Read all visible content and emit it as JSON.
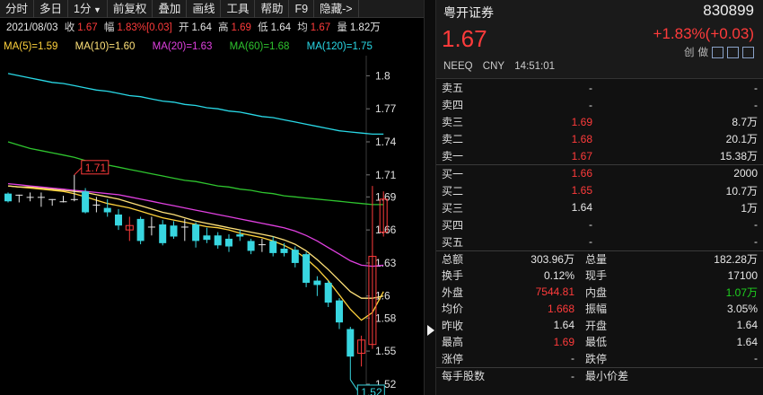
{
  "toolbar": {
    "items": [
      "分时",
      "多日",
      "1分",
      "前复权",
      "叠加",
      "画线",
      "工具",
      "帮助",
      "F9",
      "隐藏->"
    ]
  },
  "info": {
    "date": "2021/08/03",
    "close_label": "收",
    "close": "1.67",
    "range_label": "幅",
    "range": "1.83%[0.03]",
    "open_label": "开",
    "open": "1.64",
    "high_label": "高",
    "high": "1.69",
    "low_label": "低",
    "low": "1.64",
    "avg_label": "均",
    "avg": "1.67",
    "vol_label": "量",
    "vol": "1.82万"
  },
  "ma": [
    {
      "label": "MA(5)=1.59",
      "color": "#ffd23c"
    },
    {
      "label": "MA(10)=1.60",
      "color": "#ffe27a"
    },
    {
      "label": "MA(20)=1.63",
      "color": "#e040e0"
    },
    {
      "label": "MA(60)=1.68",
      "color": "#2fc52f"
    },
    {
      "label": "MA(120)=1.75",
      "color": "#29d8e6"
    }
  ],
  "chart_data": {
    "type": "candlestick",
    "y_ticks": [
      "1.8",
      "1.77",
      "1.74",
      "1.71",
      "1.69",
      "1.66",
      "1.63",
      "1.6",
      "1.58",
      "1.55",
      "1.52"
    ],
    "ylim": [
      1.515,
      1.815
    ],
    "max_label": "1.71",
    "min_label": "1.52",
    "candles": [
      {
        "o": 1.693,
        "c": 1.686,
        "h": 1.694,
        "l": 1.685
      },
      {
        "o": 1.692,
        "c": 1.692,
        "h": 1.692,
        "l": 1.685
      },
      {
        "o": 1.69,
        "c": 1.69,
        "h": 1.694,
        "l": 1.686
      },
      {
        "o": 1.69,
        "c": 1.69,
        "h": 1.694,
        "l": 1.681
      },
      {
        "o": 1.688,
        "c": 1.688,
        "h": 1.688,
        "l": 1.682
      },
      {
        "o": 1.686,
        "c": 1.686,
        "h": 1.691,
        "l": 1.685
      },
      {
        "o": 1.688,
        "c": 1.688,
        "h": 1.71,
        "l": 1.686
      },
      {
        "o": 1.695,
        "c": 1.676,
        "h": 1.698,
        "l": 1.675
      },
      {
        "o": 1.683,
        "c": 1.683,
        "h": 1.69,
        "l": 1.676
      },
      {
        "o": 1.68,
        "c": 1.676,
        "h": 1.688,
        "l": 1.672
      },
      {
        "o": 1.674,
        "c": 1.664,
        "h": 1.679,
        "l": 1.66
      },
      {
        "o": 1.66,
        "c": 1.664,
        "h": 1.672,
        "l": 1.65
      },
      {
        "o": 1.67,
        "c": 1.65,
        "h": 1.672,
        "l": 1.647
      },
      {
        "o": 1.663,
        "c": 1.663,
        "h": 1.672,
        "l": 1.655
      },
      {
        "o": 1.665,
        "c": 1.648,
        "h": 1.669,
        "l": 1.646
      },
      {
        "o": 1.664,
        "c": 1.654,
        "h": 1.668,
        "l": 1.652
      },
      {
        "o": 1.663,
        "c": 1.663,
        "h": 1.67,
        "l": 1.65
      },
      {
        "o": 1.665,
        "c": 1.65,
        "h": 1.667,
        "l": 1.644
      },
      {
        "o": 1.655,
        "c": 1.651,
        "h": 1.662,
        "l": 1.648
      },
      {
        "o": 1.655,
        "c": 1.646,
        "h": 1.658,
        "l": 1.643
      },
      {
        "o": 1.652,
        "c": 1.645,
        "h": 1.656,
        "l": 1.64
      },
      {
        "o": 1.656,
        "c": 1.654,
        "h": 1.66,
        "l": 1.65
      },
      {
        "o": 1.65,
        "c": 1.641,
        "h": 1.652,
        "l": 1.638
      },
      {
        "o": 1.647,
        "c": 1.647,
        "h": 1.652,
        "l": 1.64
      },
      {
        "o": 1.65,
        "c": 1.639,
        "h": 1.654,
        "l": 1.636
      },
      {
        "o": 1.643,
        "c": 1.639,
        "h": 1.648,
        "l": 1.636
      },
      {
        "o": 1.642,
        "c": 1.63,
        "h": 1.645,
        "l": 1.626
      },
      {
        "o": 1.638,
        "c": 1.612,
        "h": 1.64,
        "l": 1.608
      },
      {
        "o": 1.614,
        "c": 1.61,
        "h": 1.618,
        "l": 1.6
      },
      {
        "o": 1.612,
        "c": 1.594,
        "h": 1.614,
        "l": 1.59
      },
      {
        "o": 1.596,
        "c": 1.576,
        "h": 1.598,
        "l": 1.57
      },
      {
        "o": 1.57,
        "c": 1.545,
        "h": 1.572,
        "l": 1.524
      },
      {
        "o": 1.548,
        "c": 1.56,
        "h": 1.564,
        "l": 1.536
      },
      {
        "o": 1.556,
        "c": 1.636,
        "h": 1.7,
        "l": 1.552
      },
      {
        "o": 1.658,
        "c": 1.688,
        "h": 1.695,
        "l": 1.654
      }
    ],
    "ma_lines": {
      "ma5": [
        1.7,
        1.699,
        1.698,
        1.697,
        1.696,
        1.695,
        1.693,
        1.69,
        1.687,
        1.684,
        1.682,
        1.68,
        1.677,
        1.674,
        1.671,
        1.669,
        1.667,
        1.665,
        1.663,
        1.662,
        1.66,
        1.657,
        1.655,
        1.653,
        1.65,
        1.646,
        1.641,
        1.634,
        1.625,
        1.614,
        1.601,
        1.588,
        1.578,
        1.585,
        1.604
      ],
      "ma10": [
        1.7,
        1.699,
        1.699,
        1.698,
        1.697,
        1.696,
        1.695,
        1.694,
        1.692,
        1.69,
        1.688,
        1.685,
        1.682,
        1.679,
        1.676,
        1.674,
        1.671,
        1.668,
        1.666,
        1.664,
        1.662,
        1.66,
        1.658,
        1.656,
        1.654,
        1.651,
        1.647,
        1.641,
        1.633,
        1.624,
        1.614,
        1.604,
        1.598,
        1.598,
        1.6
      ],
      "ma20": [
        1.702,
        1.701,
        1.7,
        1.699,
        1.698,
        1.697,
        1.696,
        1.695,
        1.694,
        1.693,
        1.692,
        1.69,
        1.688,
        1.686,
        1.684,
        1.682,
        1.68,
        1.678,
        1.676,
        1.674,
        1.672,
        1.67,
        1.668,
        1.666,
        1.664,
        1.662,
        1.659,
        1.655,
        1.65,
        1.644,
        1.638,
        1.632,
        1.628,
        1.627,
        1.628
      ],
      "ma60": [
        1.74,
        1.737,
        1.734,
        1.732,
        1.73,
        1.728,
        1.726,
        1.723,
        1.721,
        1.719,
        1.717,
        1.715,
        1.713,
        1.711,
        1.709,
        1.707,
        1.705,
        1.704,
        1.702,
        1.7,
        1.699,
        1.697,
        1.696,
        1.694,
        1.693,
        1.691,
        1.69,
        1.689,
        1.688,
        1.687,
        1.686,
        1.685,
        1.684,
        1.683,
        1.683
      ],
      "ma120": [
        1.802,
        1.8,
        1.798,
        1.796,
        1.794,
        1.793,
        1.791,
        1.789,
        1.787,
        1.786,
        1.784,
        1.782,
        1.781,
        1.779,
        1.777,
        1.776,
        1.774,
        1.773,
        1.771,
        1.77,
        1.768,
        1.767,
        1.765,
        1.763,
        1.762,
        1.76,
        1.758,
        1.756,
        1.754,
        1.752,
        1.75,
        1.749,
        1.748,
        1.747,
        1.747
      ]
    }
  },
  "quote": {
    "name": "粤开证券",
    "code": "830899",
    "price": "1.67",
    "change": "+1.83%(+0.03)",
    "tag1": "创",
    "tag2": "做",
    "market": "NEEQ",
    "currency": "CNY",
    "time": "14:51:01"
  },
  "sells": [
    {
      "label": "卖五",
      "price": "-",
      "vol": "-"
    },
    {
      "label": "卖四",
      "price": "-",
      "vol": "-"
    },
    {
      "label": "卖三",
      "price": "1.69",
      "vol": "8.7万"
    },
    {
      "label": "卖二",
      "price": "1.68",
      "vol": "20.1万"
    },
    {
      "label": "卖一",
      "price": "1.67",
      "vol": "15.38万"
    }
  ],
  "buys": [
    {
      "label": "买一",
      "price": "1.66",
      "vol": "2000"
    },
    {
      "label": "买二",
      "price": "1.65",
      "vol": "10.7万"
    },
    {
      "label": "买三",
      "price": "1.64",
      "vol": "1万"
    },
    {
      "label": "买四",
      "price": "-",
      "vol": "-"
    },
    {
      "label": "买五",
      "price": "-",
      "vol": "-"
    }
  ],
  "stats": [
    {
      "l1": "总额",
      "v1": "303.96万",
      "l2": "总量",
      "v2": "182.28万"
    },
    {
      "l1": "换手",
      "v1": "0.12%",
      "l2": "现手",
      "v2": "17100"
    },
    {
      "l1": "外盘",
      "v1": "7544.81",
      "l2": "内盘",
      "v2": "1.07万"
    },
    {
      "l1": "均价",
      "v1": "1.668",
      "l2": "振幅",
      "v2": "3.05%"
    },
    {
      "l1": "昨收",
      "v1": "1.64",
      "l2": "开盘",
      "v2": "1.64"
    },
    {
      "l1": "最高",
      "v1": "1.69",
      "l2": "最低",
      "v2": "1.64"
    },
    {
      "l1": "涨停",
      "v1": "-",
      "l2": "跌停",
      "v2": "-"
    }
  ],
  "lot": {
    "label": "每手股数",
    "value": "-",
    "label2": "最小价差",
    "value2": ""
  }
}
